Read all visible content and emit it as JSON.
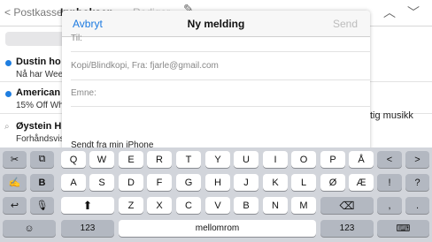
{
  "background": {
    "nav": {
      "back_label": "Postkasser",
      "inbox_label": "Innboksen",
      "edit_label": "Rediger",
      "compose_icon": "compose-icon",
      "up_icon": "chevron-up-icon",
      "down_icon": "chevron-down-icon"
    },
    "messages": [
      {
        "sender": "Dustin ho",
        "snippet": "Nå har Wee",
        "unread": true
      },
      {
        "sender": "American",
        "snippet": "15% Off Wh",
        "unread": true
      },
      {
        "sender": "Øystein H",
        "snippet": "Forhåndsvis",
        "unread": false,
        "attachment": true
      }
    ],
    "detail_text": "tig musikk"
  },
  "compose": {
    "cancel_label": "Avbryt",
    "title": "Ny melding",
    "send_label": "Send",
    "to_label": "Til:",
    "cc_label": "Kopi/Blindkopi, Fra: fjarle@gmail.com",
    "subject_label": "Emne:",
    "signature": "Sendt fra min iPhone"
  },
  "keyboard": {
    "row1": [
      "Q",
      "W",
      "E",
      "R",
      "T",
      "Y",
      "U",
      "I",
      "O",
      "P",
      "Å"
    ],
    "row2": [
      "A",
      "S",
      "D",
      "F",
      "G",
      "H",
      "J",
      "K",
      "L",
      "Ø",
      "Æ"
    ],
    "row3": [
      "Z",
      "X",
      "C",
      "V",
      "B",
      "N",
      "M"
    ],
    "undo_icon": "undo-icon",
    "bold_label": "B",
    "left_tools": [
      "scissors-icon",
      "copy-icon",
      "paste-icon",
      "microphone-icon"
    ],
    "right_keys_row1": [
      "<",
      ">"
    ],
    "right_keys_row2": [
      "!",
      "?"
    ],
    "right_keys_row3": [
      ",",
      "."
    ],
    "shift_icon": "shift-icon",
    "backspace_icon": "backspace-icon",
    "emoji_icon": "emoji-icon",
    "numbers_label": "123",
    "space_label": "mellomrom",
    "numbers_label_right": "123",
    "keyboard_icon": "keyboard-hide-icon"
  }
}
